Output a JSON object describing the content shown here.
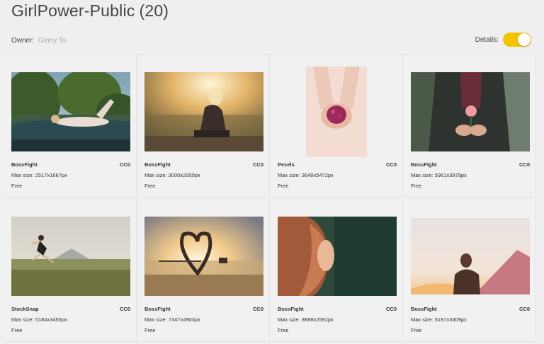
{
  "header": {
    "title": "GirlPower-Public",
    "count": "(20)",
    "owner_label": "Owner:",
    "owner_name": "Ginny To",
    "details_label": "Details:"
  },
  "colors": {
    "toggle_on": "#f4c400",
    "background": "#efefef"
  },
  "photos": [
    {
      "source": "BossFight",
      "license": "CC0",
      "size": "Max size: 2517x1667px",
      "price": "Free"
    },
    {
      "source": "BossFight",
      "license": "CC0",
      "size": "Max size: 3000x2000px",
      "price": "Free"
    },
    {
      "source": "Pexels",
      "license": "CC0",
      "size": "Max size: 3648x5472px",
      "price": "Free"
    },
    {
      "source": "BossFight",
      "license": "CC0",
      "size": "Max size: 5961x3979px",
      "price": "Free"
    },
    {
      "source": "StockSnap",
      "license": "CC0",
      "size": "Max size: 5184x3456px",
      "price": "Free"
    },
    {
      "source": "BossFight",
      "license": "CC0",
      "size": "Max size: 7347x4903px",
      "price": "Free"
    },
    {
      "source": "BossFight",
      "license": "CC0",
      "size": "Max size: 3888x2592px",
      "price": "Free"
    },
    {
      "source": "BossFight",
      "license": "CC0",
      "size": "Max size: 5187x3309px",
      "price": "Free"
    }
  ]
}
